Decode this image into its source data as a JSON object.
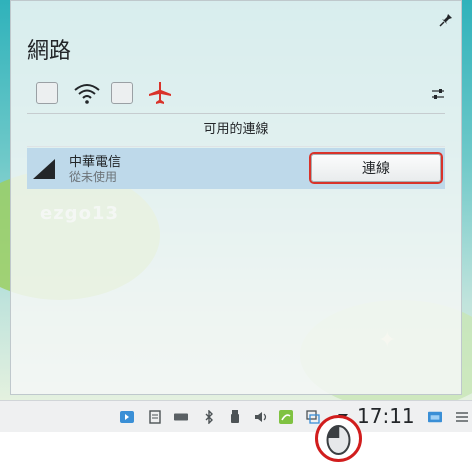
{
  "popup": {
    "title": "網路",
    "section_header": "可用的連線"
  },
  "connection": {
    "name": "中華電信",
    "status": "從未使用",
    "connect_label": "連線"
  },
  "wallpaper": {
    "logo_text": "ezgo13"
  },
  "taskbar": {
    "clock": "17:11"
  },
  "colors": {
    "selection": "#bed9ea",
    "highlight": "#d9332a",
    "airplane": "#d9332a"
  }
}
